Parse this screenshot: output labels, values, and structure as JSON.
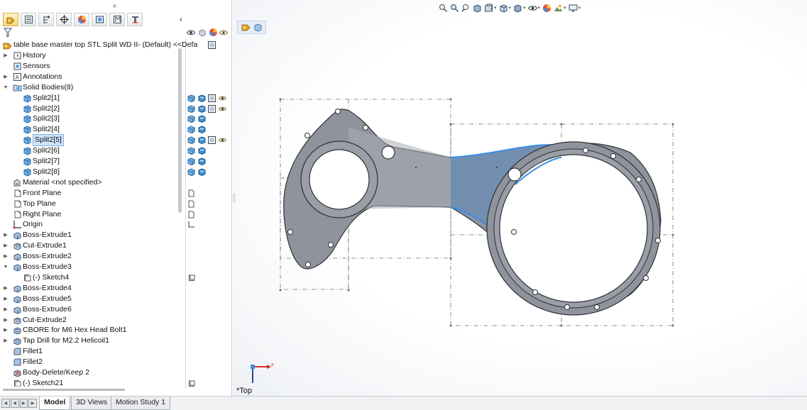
{
  "feature_manager": {
    "tabs": [
      {
        "icon": "featuremanager-icon",
        "active": true
      },
      {
        "icon": "propertymanager-icon",
        "active": false
      },
      {
        "icon": "configurationmanager-icon",
        "active": false
      },
      {
        "icon": "dimxpert-icon",
        "active": false
      },
      {
        "icon": "display-manager-icon",
        "active": false
      },
      {
        "icon": "cam-icon",
        "active": false
      },
      {
        "icon": "mbd-icon",
        "active": false
      },
      {
        "icon": "simulation-icon",
        "active": false
      }
    ],
    "root_label": "table base master top STL Split WD II- (Default) <<Defa",
    "tree": [
      {
        "label": "History",
        "level": 0,
        "expander": "▶",
        "icon": "history-icon"
      },
      {
        "label": "Sensors",
        "level": 0,
        "expander": "",
        "icon": "sensors-icon"
      },
      {
        "label": "Annotations",
        "level": 0,
        "expander": "▶",
        "icon": "annotations-icon"
      },
      {
        "label": "Solid Bodies(8)",
        "level": 0,
        "expander": "▼",
        "icon": "solid-bodies-folder-icon"
      },
      {
        "label": "Split2[1]",
        "level": 1,
        "expander": "",
        "icon": "solid-body-icon"
      },
      {
        "label": "Split2[2]",
        "level": 1,
        "expander": "",
        "icon": "solid-body-icon"
      },
      {
        "label": "Split2[3]",
        "level": 1,
        "expander": "",
        "icon": "solid-body-icon"
      },
      {
        "label": "Split2[4]",
        "level": 1,
        "expander": "",
        "icon": "solid-body-icon"
      },
      {
        "label": "Split2[5]",
        "level": 1,
        "expander": "",
        "icon": "solid-body-icon",
        "selected": true
      },
      {
        "label": "Split2[6]",
        "level": 1,
        "expander": "",
        "icon": "solid-body-icon"
      },
      {
        "label": "Split2[7]",
        "level": 1,
        "expander": "",
        "icon": "solid-body-icon"
      },
      {
        "label": "Split2[8]",
        "level": 1,
        "expander": "",
        "icon": "solid-body-icon"
      },
      {
        "label": "Material <not specified>",
        "level": 0,
        "expander": "",
        "icon": "material-icon"
      },
      {
        "label": "Front Plane",
        "level": 0,
        "expander": "",
        "icon": "plane-icon"
      },
      {
        "label": "Top Plane",
        "level": 0,
        "expander": "",
        "icon": "plane-icon"
      },
      {
        "label": "Right Plane",
        "level": 0,
        "expander": "",
        "icon": "plane-icon"
      },
      {
        "label": "Origin",
        "level": 0,
        "expander": "",
        "icon": "origin-icon"
      },
      {
        "label": "Boss-Extrude1",
        "level": 0,
        "expander": "▶",
        "icon": "extrude-icon"
      },
      {
        "label": "Cut-Extrude1",
        "level": 0,
        "expander": "▶",
        "icon": "cut-extrude-icon"
      },
      {
        "label": "Boss-Extrude2",
        "level": 0,
        "expander": "▶",
        "icon": "extrude-icon"
      },
      {
        "label": "Boss-Extrude3",
        "level": 0,
        "expander": "▼",
        "icon": "extrude-icon"
      },
      {
        "label": "(-) Sketch4",
        "level": 1,
        "expander": "",
        "icon": "sketch-icon"
      },
      {
        "label": "Boss-Extrude4",
        "level": 0,
        "expander": "▶",
        "icon": "extrude-icon"
      },
      {
        "label": "Boss-Extrude5",
        "level": 0,
        "expander": "▶",
        "icon": "extrude-icon"
      },
      {
        "label": "Boss-Extrude6",
        "level": 0,
        "expander": "▶",
        "icon": "extrude-icon"
      },
      {
        "label": "Cut-Extrude2",
        "level": 0,
        "expander": "▶",
        "icon": "cut-extrude-icon"
      },
      {
        "label": "CBORE for M6 Hex Head Bolt1",
        "level": 0,
        "expander": "▶",
        "icon": "hole-wizard-icon"
      },
      {
        "label": "Tap Drill for M2.2 Helicoil1",
        "level": 0,
        "expander": "▶",
        "icon": "hole-wizard-icon"
      },
      {
        "label": "Fillet1",
        "level": 0,
        "expander": "",
        "icon": "fillet-icon"
      },
      {
        "label": "Fillet2",
        "level": 0,
        "expander": "",
        "icon": "fillet-icon"
      },
      {
        "label": "Body-Delete/Keep 2",
        "level": 0,
        "expander": "",
        "icon": "body-delete-icon"
      },
      {
        "label": "(-) Sketch21",
        "level": 0,
        "expander": "",
        "icon": "sketch-icon"
      }
    ]
  },
  "bottom_tabs": [
    {
      "label": "Model",
      "active": true
    },
    {
      "label": "3D Views",
      "active": false
    },
    {
      "label": "Motion Study 1",
      "active": false
    }
  ],
  "graphics": {
    "view_label": "*Top",
    "triad": {
      "x_label": "x"
    },
    "hud_icons": [
      "zoom-to-fit-icon",
      "zoom-to-area-icon",
      "previous-view-icon",
      "section-view-icon",
      "dynamic-annotation-icon",
      "view-orientation-icon",
      "display-style-icon",
      "hide-show-icon",
      "edit-appearance-icon",
      "apply-scene-icon",
      "view-settings-icon"
    ],
    "config_badge_icons": [
      "part-icon",
      "body-icon"
    ]
  },
  "colors": {
    "accent_blue": "#3a8ee6",
    "body_gray": "#8e939c",
    "selected_body": "#6f8fb3",
    "selection_bg": "#cce3fb"
  }
}
